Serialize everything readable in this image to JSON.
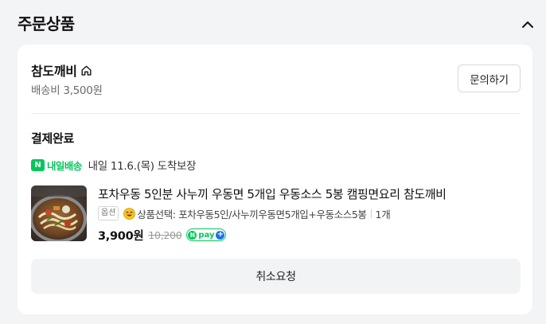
{
  "section": {
    "title": "주문상품",
    "toggle_icon": "chevron-up-icon"
  },
  "seller": {
    "name": "참도깨비",
    "home_icon": "home-icon",
    "shipping_fee": "배송비 3,500원",
    "inquiry_label": "문의하기"
  },
  "order": {
    "status": "결제완료",
    "delivery_badge_letter": "N",
    "delivery_badge_text": "내일배송",
    "delivery_guarantee": "내일 11.6.(목) 도착보장"
  },
  "product": {
    "image_icon": "noodle-dish-image",
    "title": "포차우동 5인분 사누끼 우동면 5개입 우동소스 5봉 캠핑면요리 참도깨비",
    "option_tag": "옵션",
    "option_emoji_icon": "smile-emoji-icon",
    "option_text": "상품선택: 포차우동5인/사누끼우동면5개입+우동소스5봉",
    "quantity": "1개",
    "price": "3,900원",
    "original_price": "10,200",
    "npay_n": "N",
    "npay_text": "pay",
    "npay_plus": "+"
  },
  "actions": {
    "cancel_label": "취소요청"
  },
  "colors": {
    "brand_green": "#03c75a",
    "npay_plus_blue": "#1a73e8",
    "background": "#f3f4f6",
    "card": "#ffffff"
  }
}
